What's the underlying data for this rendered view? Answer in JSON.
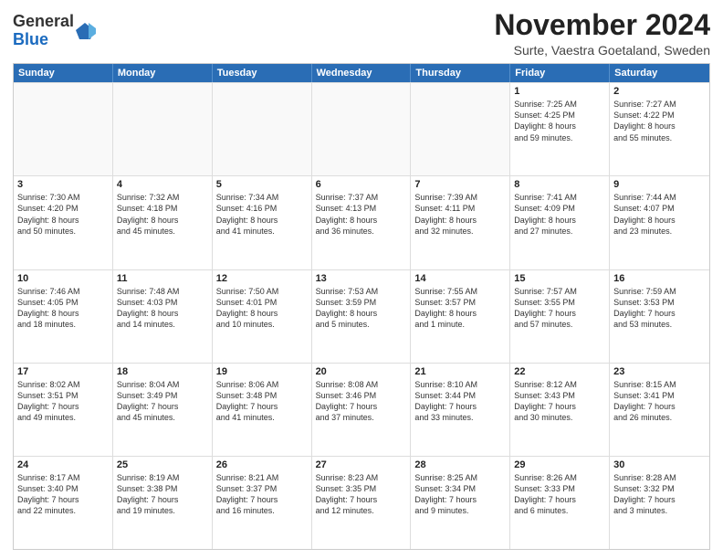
{
  "logo": {
    "general": "General",
    "blue": "Blue"
  },
  "title": "November 2024",
  "subtitle": "Surte, Vaestra Goetaland, Sweden",
  "header_days": [
    "Sunday",
    "Monday",
    "Tuesday",
    "Wednesday",
    "Thursday",
    "Friday",
    "Saturday"
  ],
  "weeks": [
    [
      {
        "day": "",
        "info": ""
      },
      {
        "day": "",
        "info": ""
      },
      {
        "day": "",
        "info": ""
      },
      {
        "day": "",
        "info": ""
      },
      {
        "day": "",
        "info": ""
      },
      {
        "day": "1",
        "info": "Sunrise: 7:25 AM\nSunset: 4:25 PM\nDaylight: 8 hours\nand 59 minutes."
      },
      {
        "day": "2",
        "info": "Sunrise: 7:27 AM\nSunset: 4:22 PM\nDaylight: 8 hours\nand 55 minutes."
      }
    ],
    [
      {
        "day": "3",
        "info": "Sunrise: 7:30 AM\nSunset: 4:20 PM\nDaylight: 8 hours\nand 50 minutes."
      },
      {
        "day": "4",
        "info": "Sunrise: 7:32 AM\nSunset: 4:18 PM\nDaylight: 8 hours\nand 45 minutes."
      },
      {
        "day": "5",
        "info": "Sunrise: 7:34 AM\nSunset: 4:16 PM\nDaylight: 8 hours\nand 41 minutes."
      },
      {
        "day": "6",
        "info": "Sunrise: 7:37 AM\nSunset: 4:13 PM\nDaylight: 8 hours\nand 36 minutes."
      },
      {
        "day": "7",
        "info": "Sunrise: 7:39 AM\nSunset: 4:11 PM\nDaylight: 8 hours\nand 32 minutes."
      },
      {
        "day": "8",
        "info": "Sunrise: 7:41 AM\nSunset: 4:09 PM\nDaylight: 8 hours\nand 27 minutes."
      },
      {
        "day": "9",
        "info": "Sunrise: 7:44 AM\nSunset: 4:07 PM\nDaylight: 8 hours\nand 23 minutes."
      }
    ],
    [
      {
        "day": "10",
        "info": "Sunrise: 7:46 AM\nSunset: 4:05 PM\nDaylight: 8 hours\nand 18 minutes."
      },
      {
        "day": "11",
        "info": "Sunrise: 7:48 AM\nSunset: 4:03 PM\nDaylight: 8 hours\nand 14 minutes."
      },
      {
        "day": "12",
        "info": "Sunrise: 7:50 AM\nSunset: 4:01 PM\nDaylight: 8 hours\nand 10 minutes."
      },
      {
        "day": "13",
        "info": "Sunrise: 7:53 AM\nSunset: 3:59 PM\nDaylight: 8 hours\nand 5 minutes."
      },
      {
        "day": "14",
        "info": "Sunrise: 7:55 AM\nSunset: 3:57 PM\nDaylight: 8 hours\nand 1 minute."
      },
      {
        "day": "15",
        "info": "Sunrise: 7:57 AM\nSunset: 3:55 PM\nDaylight: 7 hours\nand 57 minutes."
      },
      {
        "day": "16",
        "info": "Sunrise: 7:59 AM\nSunset: 3:53 PM\nDaylight: 7 hours\nand 53 minutes."
      }
    ],
    [
      {
        "day": "17",
        "info": "Sunrise: 8:02 AM\nSunset: 3:51 PM\nDaylight: 7 hours\nand 49 minutes."
      },
      {
        "day": "18",
        "info": "Sunrise: 8:04 AM\nSunset: 3:49 PM\nDaylight: 7 hours\nand 45 minutes."
      },
      {
        "day": "19",
        "info": "Sunrise: 8:06 AM\nSunset: 3:48 PM\nDaylight: 7 hours\nand 41 minutes."
      },
      {
        "day": "20",
        "info": "Sunrise: 8:08 AM\nSunset: 3:46 PM\nDaylight: 7 hours\nand 37 minutes."
      },
      {
        "day": "21",
        "info": "Sunrise: 8:10 AM\nSunset: 3:44 PM\nDaylight: 7 hours\nand 33 minutes."
      },
      {
        "day": "22",
        "info": "Sunrise: 8:12 AM\nSunset: 3:43 PM\nDaylight: 7 hours\nand 30 minutes."
      },
      {
        "day": "23",
        "info": "Sunrise: 8:15 AM\nSunset: 3:41 PM\nDaylight: 7 hours\nand 26 minutes."
      }
    ],
    [
      {
        "day": "24",
        "info": "Sunrise: 8:17 AM\nSunset: 3:40 PM\nDaylight: 7 hours\nand 22 minutes."
      },
      {
        "day": "25",
        "info": "Sunrise: 8:19 AM\nSunset: 3:38 PM\nDaylight: 7 hours\nand 19 minutes."
      },
      {
        "day": "26",
        "info": "Sunrise: 8:21 AM\nSunset: 3:37 PM\nDaylight: 7 hours\nand 16 minutes."
      },
      {
        "day": "27",
        "info": "Sunrise: 8:23 AM\nSunset: 3:35 PM\nDaylight: 7 hours\nand 12 minutes."
      },
      {
        "day": "28",
        "info": "Sunrise: 8:25 AM\nSunset: 3:34 PM\nDaylight: 7 hours\nand 9 minutes."
      },
      {
        "day": "29",
        "info": "Sunrise: 8:26 AM\nSunset: 3:33 PM\nDaylight: 7 hours\nand 6 minutes."
      },
      {
        "day": "30",
        "info": "Sunrise: 8:28 AM\nSunset: 3:32 PM\nDaylight: 7 hours\nand 3 minutes."
      }
    ]
  ]
}
